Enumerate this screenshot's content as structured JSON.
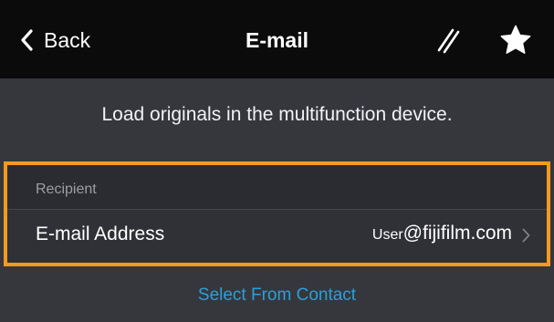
{
  "navbar": {
    "back_label": "Back",
    "title": "E-mail",
    "icons": {
      "back": "chevron-left-icon",
      "edit": "edit-icon",
      "favorite": "star-icon"
    }
  },
  "instruction": "Load originals in the multifunction device.",
  "recipient_section": {
    "header": "Recipient",
    "email_row": {
      "label": "E-mail Address",
      "value_user": "User",
      "value_domain": "@fijifilm.com",
      "icon": "chevron-right-icon"
    }
  },
  "select_contact_label": "Select From Contact",
  "colors": {
    "navbar_bg": "#0b0b0c",
    "page_bg": "#36373d",
    "highlight_border": "#f79a1c",
    "link": "#2b9fd9"
  }
}
